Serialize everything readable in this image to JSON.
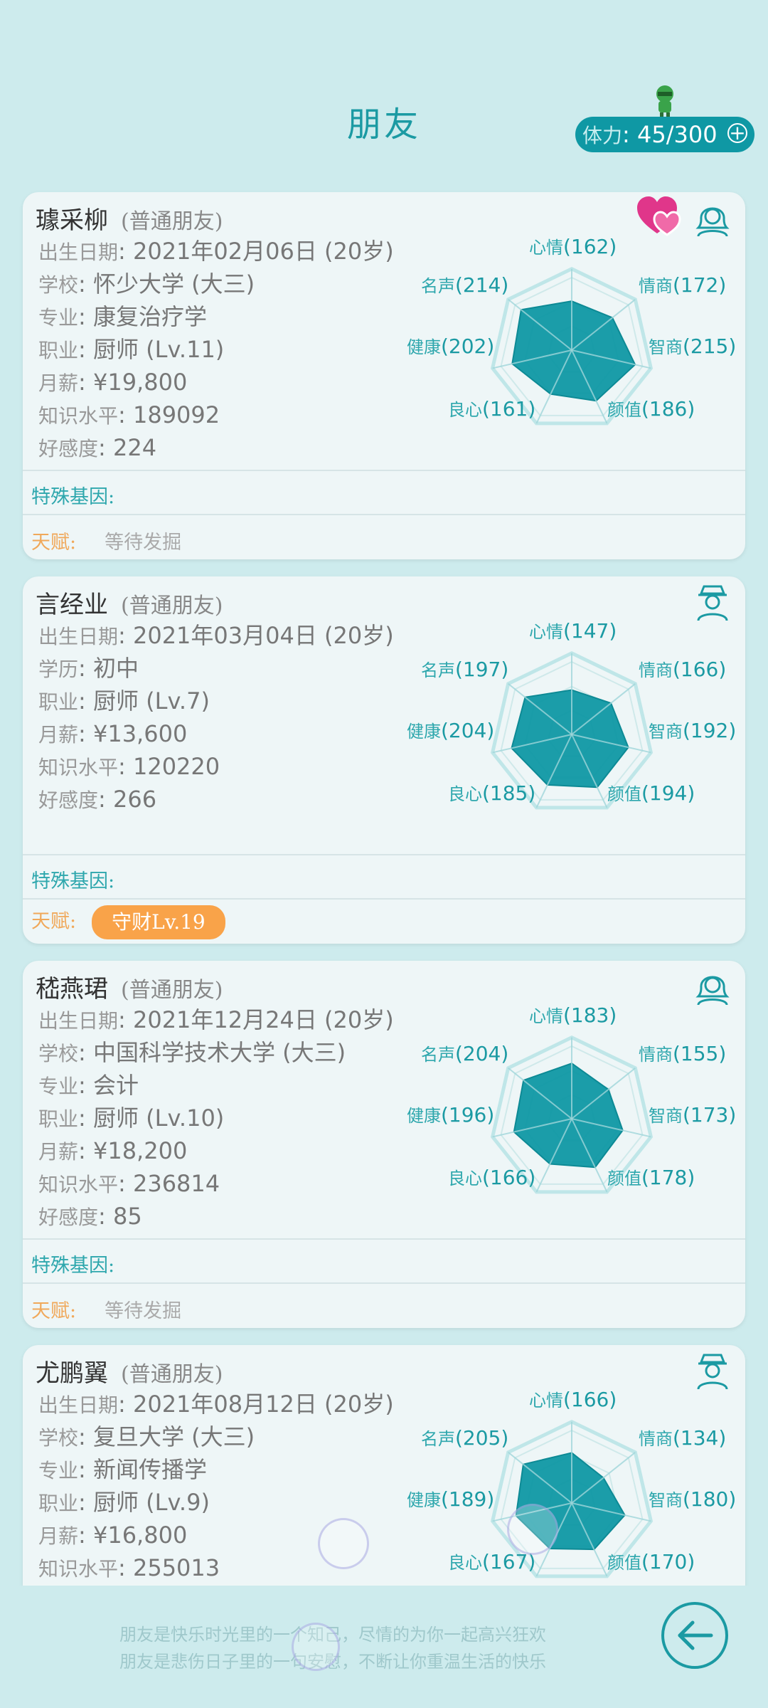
{
  "title": "朋友",
  "stamina": {
    "label": "体力",
    "value": ": 45/300"
  },
  "friends": [
    {
      "name": "璩采柳",
      "relation": "(普通朋友)",
      "gender": "female",
      "liked": true,
      "birth": {
        "k": "出生日期",
        "v": ": 2021年02月06日 (20岁)"
      },
      "rows": [
        {
          "k": "学校",
          "v": ": 怀少大学 (大三)"
        },
        {
          "k": "专业",
          "v": ": 康复治疗学"
        },
        {
          "k": "职业",
          "v": ": 厨师 (Lv.11)"
        },
        {
          "k": "月薪",
          "v": ": ¥19,800"
        },
        {
          "k": "知识水平",
          "v": ": 189092"
        },
        {
          "k": "好感度",
          "v": ": 224"
        }
      ],
      "gene_label": "特殊基因:",
      "talent_label": "天赋:",
      "talent_value": "等待发掘",
      "stats": [
        {
          "key": "心情",
          "value": "(162)",
          "n": 162
        },
        {
          "key": "情商",
          "value": "(172)",
          "n": 172
        },
        {
          "key": "智商",
          "value": "(215)",
          "n": 215
        },
        {
          "key": "颜值",
          "value": "(186)",
          "n": 186
        },
        {
          "key": "良心",
          "value": "(161)",
          "n": 161
        },
        {
          "key": "健康",
          "value": "(202)",
          "n": 202
        },
        {
          "key": "名声",
          "value": "(214)",
          "n": 214
        }
      ]
    },
    {
      "name": "言经业",
      "relation": "(普通朋友)",
      "gender": "male",
      "liked": false,
      "birth": {
        "k": "出生日期",
        "v": ": 2021年03月04日 (20岁)"
      },
      "rows": [
        {
          "k": "学历",
          "v": ": 初中"
        },
        {
          "k": "职业",
          "v": ": 厨师 (Lv.7)"
        },
        {
          "k": "月薪",
          "v": ": ¥13,600"
        },
        {
          "k": "知识水平",
          "v": ": 120220"
        },
        {
          "k": "好感度",
          "v": ": 266"
        }
      ],
      "gene_label": "特殊基因:",
      "talent_label": "天赋:",
      "talent_badge": "守财Lv.19",
      "stats": [
        {
          "key": "心情",
          "value": "(147)",
          "n": 147
        },
        {
          "key": "情商",
          "value": "(166)",
          "n": 166
        },
        {
          "key": "智商",
          "value": "(192)",
          "n": 192
        },
        {
          "key": "颜值",
          "value": "(194)",
          "n": 194
        },
        {
          "key": "良心",
          "value": "(185)",
          "n": 185
        },
        {
          "key": "健康",
          "value": "(204)",
          "n": 204
        },
        {
          "key": "名声",
          "value": "(197)",
          "n": 197
        }
      ]
    },
    {
      "name": "嵇燕珺",
      "relation": "(普通朋友)",
      "gender": "female",
      "liked": false,
      "birth": {
        "k": "出生日期",
        "v": ": 2021年12月24日 (20岁)"
      },
      "rows": [
        {
          "k": "学校",
          "v": ": 中国科学技术大学 (大三)"
        },
        {
          "k": "专业",
          "v": ": 会计"
        },
        {
          "k": "职业",
          "v": ": 厨师 (Lv.10)"
        },
        {
          "k": "月薪",
          "v": ": ¥18,200"
        },
        {
          "k": "知识水平",
          "v": ": 236814"
        },
        {
          "k": "好感度",
          "v": ": 85"
        }
      ],
      "gene_label": "特殊基因:",
      "talent_label": "天赋:",
      "talent_value": "等待发掘",
      "stats": [
        {
          "key": "心情",
          "value": "(183)",
          "n": 183
        },
        {
          "key": "情商",
          "value": "(155)",
          "n": 155
        },
        {
          "key": "智商",
          "value": "(173)",
          "n": 173
        },
        {
          "key": "颜值",
          "value": "(178)",
          "n": 178
        },
        {
          "key": "良心",
          "value": "(166)",
          "n": 166
        },
        {
          "key": "健康",
          "value": "(196)",
          "n": 196
        },
        {
          "key": "名声",
          "value": "(204)",
          "n": 204
        }
      ]
    },
    {
      "name": "尤鹏翼",
      "relation": "(普通朋友)",
      "gender": "male",
      "liked": false,
      "birth": {
        "k": "出生日期",
        "v": ": 2021年08月12日 (20岁)"
      },
      "rows": [
        {
          "k": "学校",
          "v": ": 复旦大学 (大三)"
        },
        {
          "k": "专业",
          "v": ": 新闻传播学"
        },
        {
          "k": "职业",
          "v": ": 厨师 (Lv.9)"
        },
        {
          "k": "月薪",
          "v": ": ¥16,800"
        },
        {
          "k": "知识水平",
          "v": ": 255013"
        }
      ],
      "gene_label": "",
      "talent_label": "",
      "stats": [
        {
          "key": "心情",
          "value": "(166)",
          "n": 166
        },
        {
          "key": "情商",
          "value": "(134)",
          "n": 134
        },
        {
          "key": "智商",
          "value": "(180)",
          "n": 180
        },
        {
          "key": "颜值",
          "value": "(170)",
          "n": 170
        },
        {
          "key": "良心",
          "value": "(167)",
          "n": 167
        },
        {
          "key": "健康",
          "value": "(189)",
          "n": 189
        },
        {
          "key": "名声",
          "value": "(205)",
          "n": 205
        }
      ]
    }
  ],
  "footer": {
    "quote_line1": "朋友是快乐时光里的一个知己，尽情的为你一起高兴狂欢",
    "quote_line2": "朋友是悲伤日子里的一句安慰，不断让你重温生活的快乐"
  },
  "colors": {
    "accent": "#1b9aa3",
    "radar_fill": "#0f98a4",
    "talent": "#f9a349",
    "heart": "#e0368a"
  }
}
